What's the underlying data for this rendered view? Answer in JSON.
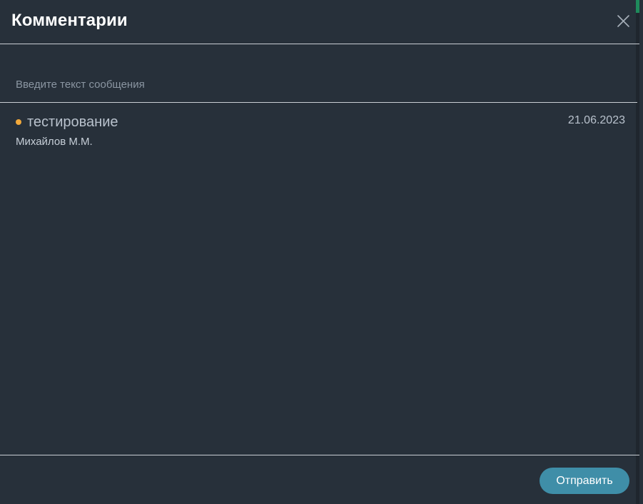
{
  "dialog": {
    "title": "Комментарии",
    "close_icon": "close-icon"
  },
  "composer": {
    "placeholder": "Введите текст сообщения",
    "value": ""
  },
  "comments": [
    {
      "text": "тестирование",
      "date": "21.06.2023",
      "author": "Михайлов М.М.",
      "status_color": "#f2a93b"
    }
  ],
  "footer": {
    "submit_label": "Отправить"
  },
  "colors": {
    "background": "#27303a",
    "accent_button": "#3f8ea8",
    "divider": "#c9ced4"
  }
}
